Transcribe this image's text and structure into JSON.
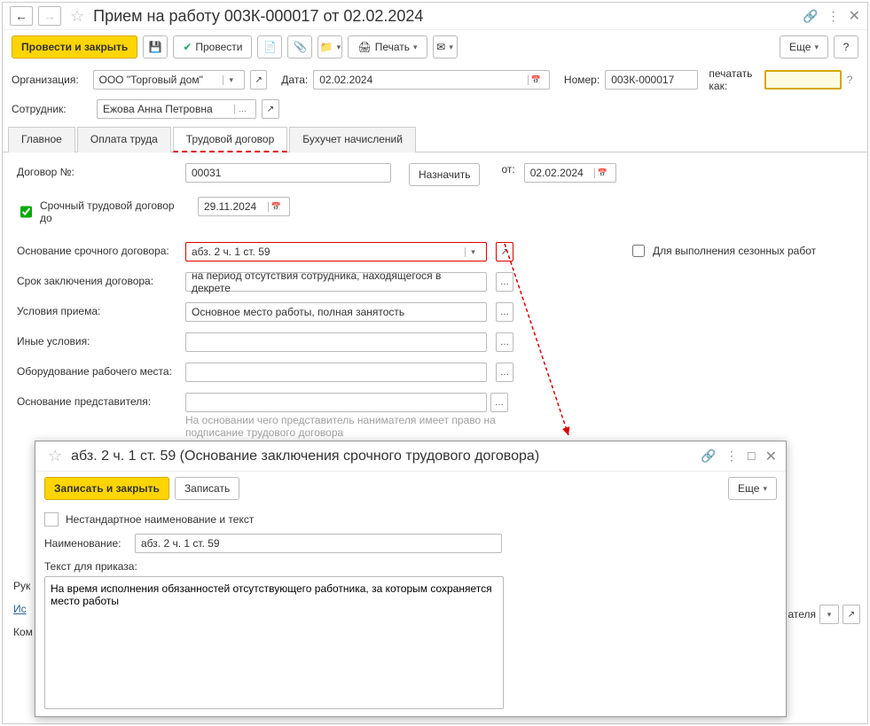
{
  "header": {
    "title": "Прием на работу 003К-000017 от 02.02.2024"
  },
  "toolbar": {
    "post_close": "Провести и закрыть",
    "post": "Провести",
    "print": "Печать",
    "more": "Еще"
  },
  "form": {
    "org_label": "Организация:",
    "org_value": "ООО \"Торговый дом\"",
    "date_label": "Дата:",
    "date_value": "02.02.2024",
    "number_label": "Номер:",
    "number_value": "003К-000017",
    "print_as_label": "печатать как:",
    "print_as_value": "",
    "employee_label": "Сотрудник:",
    "employee_value": "Ежова Анна Петровна"
  },
  "tabs": {
    "main": "Главное",
    "pay": "Оплата труда",
    "contract": "Трудовой договор",
    "accounting": "Бухучет начислений"
  },
  "contract": {
    "number_label": "Договор №:",
    "number_value": "00031",
    "assign": "Назначить",
    "from_label": "от:",
    "from_date": "02.02.2024",
    "fixed_term_label": "Срочный трудовой договор до",
    "fixed_term_date": "29.11.2024",
    "basis_label": "Основание срочного договора:",
    "basis_value": "абз. 2 ч. 1 ст. 59",
    "seasonal_label": "Для выполнения сезонных работ",
    "period_label": "Срок заключения договора:",
    "period_value": "на период отсутствия сотрудника, находящегося в декрете",
    "conditions_label": "Условия приема:",
    "conditions_value": "Основное место работы, полная занятость",
    "other_label": "Иные условия:",
    "other_value": "",
    "equipment_label": "Оборудование рабочего места:",
    "equipment_value": "",
    "rep_basis_label": "Основание представителя:",
    "rep_basis_value": "",
    "rep_help": "На основании чего представитель нанимателя имеет право на подписание трудового договора"
  },
  "bottom": {
    "ruk": "Рук",
    "isp_label": "Ис",
    "kom": "Ком",
    "atelya": "ателя"
  },
  "popup": {
    "title": "абз. 2 ч. 1 ст. 59 (Основание заключения срочного трудового договора)",
    "save_close": "Записать и закрыть",
    "save": "Записать",
    "more": "Еще",
    "nonstd_label": "Нестандартное наименование и текст",
    "name_label": "Наименование:",
    "name_value": "абз. 2 ч. 1 ст. 59",
    "order_text_label": "Текст для приказа:",
    "order_text_value": "На время исполнения обязанностей отсутствующего работника, за которым сохраняется место работы"
  }
}
